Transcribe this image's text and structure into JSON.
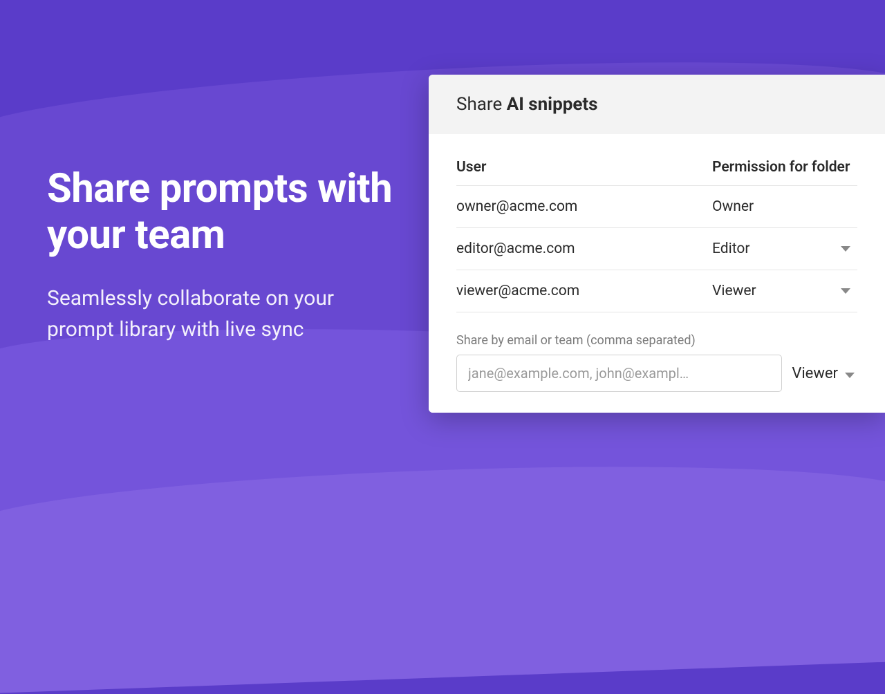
{
  "marketing": {
    "headline": "Share prompts with your team",
    "subheadline": "Seamlessly collaborate on your prompt library with live sync"
  },
  "dialog": {
    "title_prefix": "Share ",
    "title_name": "AI snippets",
    "columns": {
      "user": "User",
      "permission": "Permission for folder"
    },
    "rows": [
      {
        "email": "owner@acme.com",
        "permission": "Owner",
        "editable": false
      },
      {
        "email": "editor@acme.com",
        "permission": "Editor",
        "editable": true
      },
      {
        "email": "viewer@acme.com",
        "permission": "Viewer",
        "editable": true
      }
    ],
    "share_label": "Share by email or team (comma separated)",
    "share_placeholder": "jane@example.com, john@exampl…",
    "default_permission": "Viewer"
  }
}
